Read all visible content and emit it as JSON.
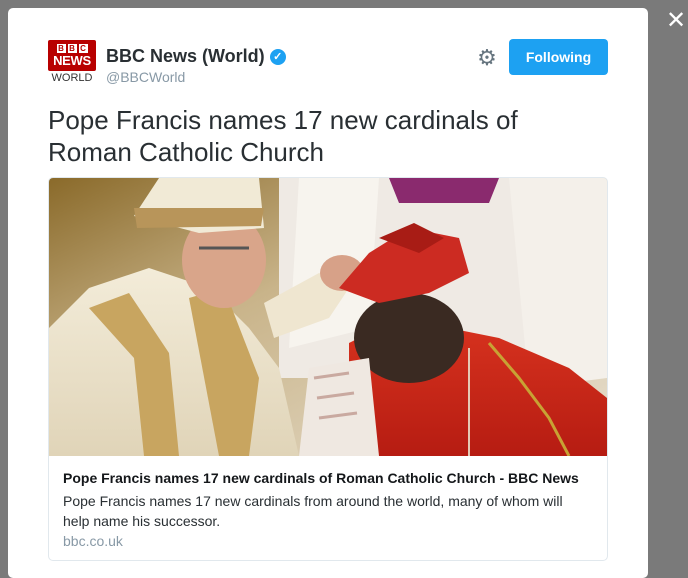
{
  "close": {
    "icon": "close-icon",
    "glyph": "✕"
  },
  "account": {
    "name": "BBC News (World)",
    "handle": "@BBCWorld",
    "verified_icon": "verified-badge-icon",
    "avatar": {
      "top": "BBC",
      "middle": "NEWS",
      "bottom": "WORLD",
      "brand_color": "#b80000"
    }
  },
  "actions": {
    "gear_icon": "gear-icon",
    "gear_glyph": "⚙",
    "follow_label": "Following",
    "accent": "#1da1f2"
  },
  "tweet": {
    "text": "Pope Francis names 17 new cardinals of Roman Catholic Church"
  },
  "card": {
    "title": "Pope Francis names 17 new cardinals of Roman Catholic Church - BBC News",
    "description": "Pope Francis names 17 new cardinals from around the world, many of whom will help name his successor.",
    "domain": "bbc.co.uk"
  }
}
